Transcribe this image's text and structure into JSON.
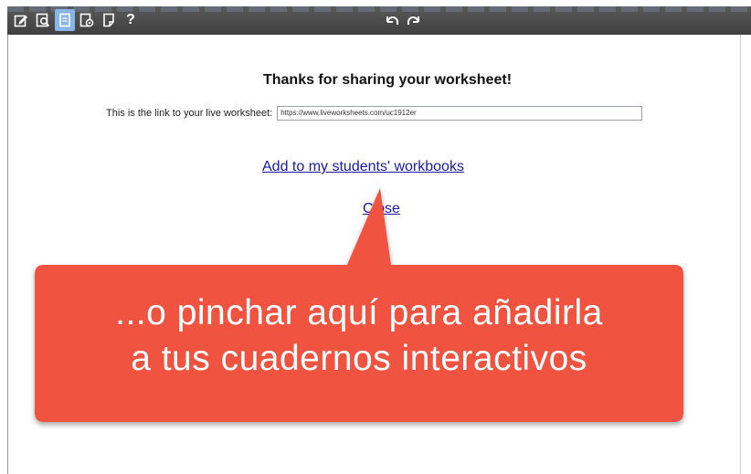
{
  "toolbar": {
    "icons": [
      "edit-icon",
      "preview-icon",
      "share-icon",
      "settings-icon",
      "document-icon",
      "help-icon",
      "undo-icon",
      "redo-icon"
    ],
    "help_label": "?",
    "active_icon": "share-icon"
  },
  "dialog": {
    "title": "Thanks for sharing your worksheet!",
    "link_label": "This is the link to your live worksheet:",
    "link_value": "https://www.liveworksheets.com/uc1912er",
    "add_link": "Add to my students' workbooks",
    "close_link": "Close"
  },
  "callout": {
    "line1": "...o pinchar aquí para añadirla",
    "line2": "a tus cuadernos interactivos",
    "color": "#f0533f"
  }
}
